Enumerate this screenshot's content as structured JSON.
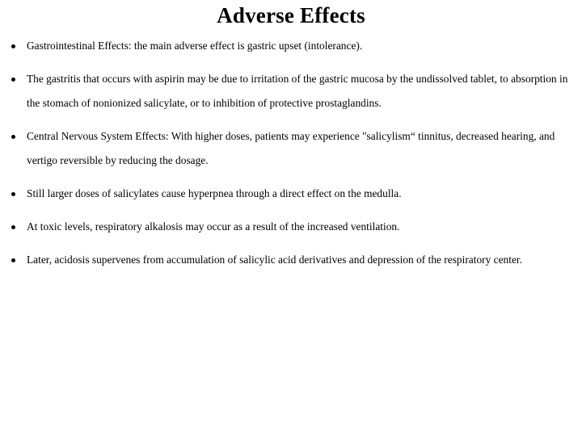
{
  "slide": {
    "title": "Adverse Effects",
    "background_color": "#ffffff",
    "text_color": "#000000",
    "bullet_marker": "filled-round-bullet",
    "bullets": [
      {
        "text": "Gastrointestinal Effects: the main adverse effect is gastric upset (intolerance)."
      },
      {
        "text": "The gastritis that occurs with aspirin may be due to irritation of the gastric mucosa by the undissolved tablet, to absorption in the stomach of nonionized salicylate, or to inhibition of protective prostaglandins."
      },
      {
        "text": "Central Nervous System Effects: With higher doses, patients may experience \"salicylism“ tinnitus, decreased hearing, and vertigo reversible by reducing the dosage."
      },
      {
        "text": "Still larger doses of salicylates cause hyperpnea through a direct effect on the medulla."
      },
      {
        "text": "At toxic levels, respiratory alkalosis may occur as a result of the increased ventilation."
      },
      {
        "text": "Later, acidosis supervenes from accumulation of salicylic acid derivatives and depression of the respiratory center."
      }
    ]
  }
}
